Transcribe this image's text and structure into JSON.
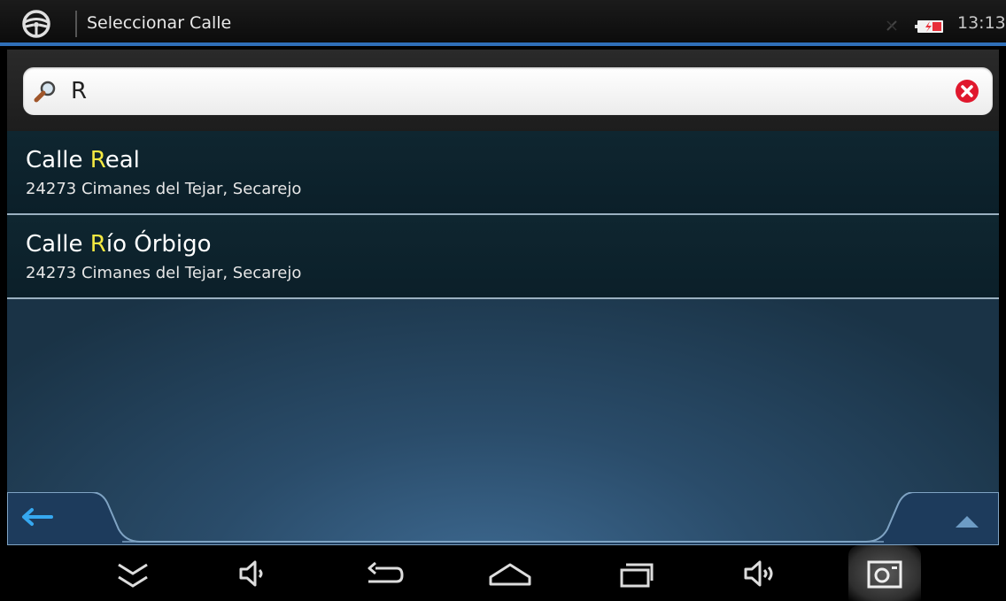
{
  "titlebar": {
    "app_icon": "steering-wheel-icon",
    "title": "Seleccionar Calle",
    "clock": "13:13",
    "battery_color": "#e8303a"
  },
  "search": {
    "value": "R",
    "placeholder": ""
  },
  "results": [
    {
      "prefix": "Calle ",
      "match": "R",
      "rest": "eal",
      "address": "24273 Cimanes del Tejar, Secarejo"
    },
    {
      "prefix": "Calle ",
      "match": "R",
      "rest": "ío Órbigo",
      "address": "24273 Cimanes del Tejar, Secarejo"
    }
  ],
  "appbar": {
    "back_icon": "arrow-left-icon",
    "up_icon": "chevron-up-icon"
  },
  "navbar": {
    "icons": [
      "chevron-down-icon",
      "volume-down-icon",
      "back-icon",
      "home-icon",
      "recents-icon",
      "volume-up-icon",
      "camera-icon"
    ]
  },
  "colors": {
    "accent": "#2f6fb8",
    "highlight": "#f5e942",
    "clear": "#e0182d"
  }
}
